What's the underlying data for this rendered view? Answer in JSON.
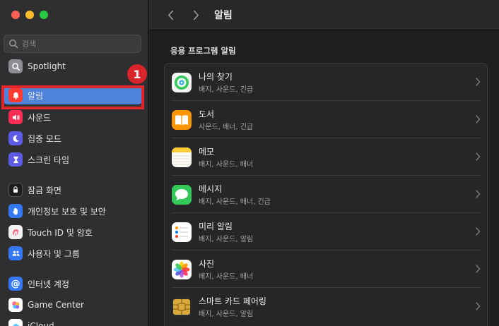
{
  "window": {
    "title": "알림"
  },
  "search": {
    "placeholder": "검색"
  },
  "sidebar": {
    "items": [
      {
        "label": "Spotlight",
        "icon": "magnifier-icon",
        "color": "#8e8e93"
      },
      {
        "label": "알림",
        "icon": "bell-icon",
        "color": "#ff3b30",
        "selected": true
      },
      {
        "label": "사운드",
        "icon": "speaker-icon",
        "color": "#ff2d55"
      },
      {
        "label": "집중 모드",
        "icon": "moon-icon",
        "color": "#5e5ce6"
      },
      {
        "label": "스크린 타임",
        "icon": "hourglass-icon",
        "color": "#5e5ce6"
      },
      {
        "label": "잠금 화면",
        "icon": "lock-icon",
        "color": "#1c1c1e"
      },
      {
        "label": "개인정보 보호 및 보안",
        "icon": "hand-icon",
        "color": "#3478f6"
      },
      {
        "label": "Touch ID 및 암호",
        "icon": "fingerprint-icon",
        "color": "#f2f2f2"
      },
      {
        "label": "사용자 및 그룹",
        "icon": "users-icon",
        "color": "#3478f6"
      },
      {
        "label": "인터넷 계정",
        "icon": "at-icon",
        "color": "#3478f6"
      },
      {
        "label": "Game Center",
        "icon": "game-center-icon",
        "color": "#ffffff"
      },
      {
        "label": "iCloud",
        "icon": "cloud-icon",
        "color": "#ffffff"
      }
    ]
  },
  "annotation": {
    "step": "1"
  },
  "main": {
    "section_title": "응용 프로그램 알림",
    "apps": [
      {
        "name": "나의 찾기",
        "sub": "배지, 사운드, 긴급",
        "icon": "find-my-icon"
      },
      {
        "name": "도서",
        "sub": "사운드, 배너, 긴급",
        "icon": "books-icon"
      },
      {
        "name": "메모",
        "sub": "배지, 사운드, 배너",
        "icon": "notes-icon"
      },
      {
        "name": "메시지",
        "sub": "배지, 사운드, 배너, 긴급",
        "icon": "messages-icon"
      },
      {
        "name": "미리 알림",
        "sub": "배지, 사운드, 알림",
        "icon": "reminders-icon"
      },
      {
        "name": "사진",
        "sub": "배지, 사운드, 배너",
        "icon": "photos-icon"
      },
      {
        "name": "스마트 카드 페어링",
        "sub": "배지, 사운드, 알림",
        "icon": "smart-card-icon"
      }
    ]
  }
}
